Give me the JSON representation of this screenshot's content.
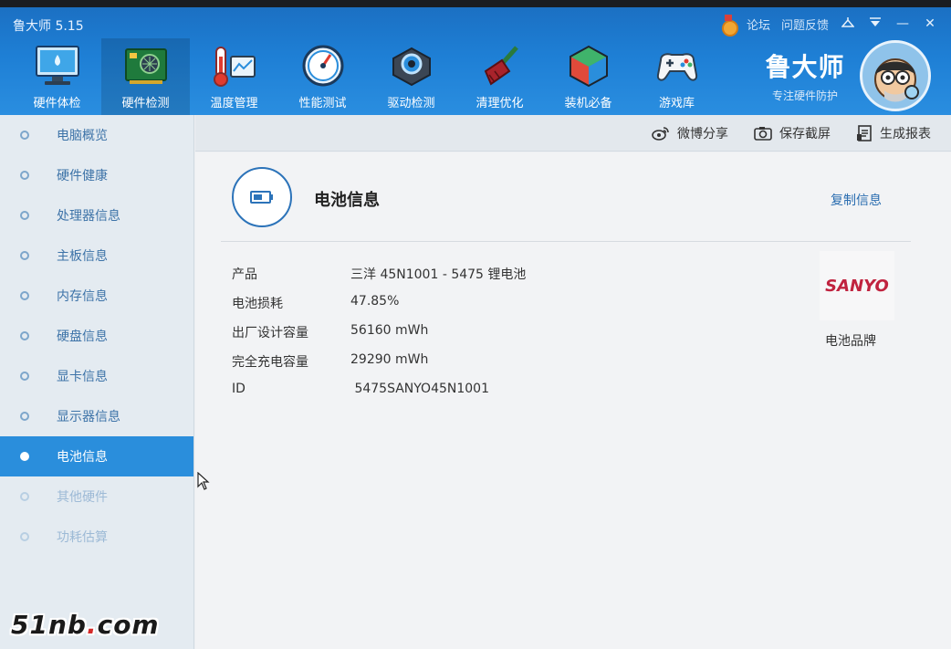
{
  "app": {
    "title": "鲁大师 5.15"
  },
  "title_links": {
    "forum": "论坛",
    "feedback": "问题反馈",
    "minimize": "—",
    "close": "✕"
  },
  "toolbar": [
    {
      "label": "硬件体检",
      "icon": "monitor-icon"
    },
    {
      "label": "硬件检测",
      "icon": "circuit-board-icon",
      "active": true
    },
    {
      "label": "温度管理",
      "icon": "thermometer-icon"
    },
    {
      "label": "性能测试",
      "icon": "speedometer-icon"
    },
    {
      "label": "驱动检测",
      "icon": "driver-gear-icon"
    },
    {
      "label": "清理优化",
      "icon": "broom-icon"
    },
    {
      "label": "装机必备",
      "icon": "cube-icon"
    },
    {
      "label": "游戏库",
      "icon": "gamepad-icon"
    }
  ],
  "brand": {
    "name": "鲁大师",
    "slogan": "专注硬件防护"
  },
  "sidebar": [
    {
      "label": "电脑概览"
    },
    {
      "label": "硬件健康"
    },
    {
      "label": "处理器信息"
    },
    {
      "label": "主板信息"
    },
    {
      "label": "内存信息"
    },
    {
      "label": "硬盘信息"
    },
    {
      "label": "显卡信息"
    },
    {
      "label": "显示器信息"
    },
    {
      "label": "电池信息",
      "active": true
    },
    {
      "label": "其他硬件"
    },
    {
      "label": "功耗估算"
    }
  ],
  "actions": {
    "weibo_share": "微博分享",
    "save_screenshot": "保存截屏",
    "generate_report": "生成报表"
  },
  "battery": {
    "title": "电池信息",
    "copy_label": "复制信息",
    "rows": [
      {
        "key": "产品",
        "value": "三洋 45N1001 -  5475 锂电池"
      },
      {
        "key": "电池损耗",
        "value": "47.85%"
      },
      {
        "key": "出厂设计容量",
        "value": "56160 mWh"
      },
      {
        "key": "完全充电容量",
        "value": "29290 mWh"
      },
      {
        "key": "ID",
        "value": " 5475SANYO45N1001"
      }
    ],
    "brand_logo": "SANYO",
    "brand_caption": "电池品牌"
  },
  "watermark": {
    "prefix": "51nb",
    "dot": ".",
    "suffix": "com"
  },
  "colors": {
    "accent": "#1e7fd5",
    "sidebar_active": "#2a8edc",
    "sanyo_red": "#c0233f"
  }
}
